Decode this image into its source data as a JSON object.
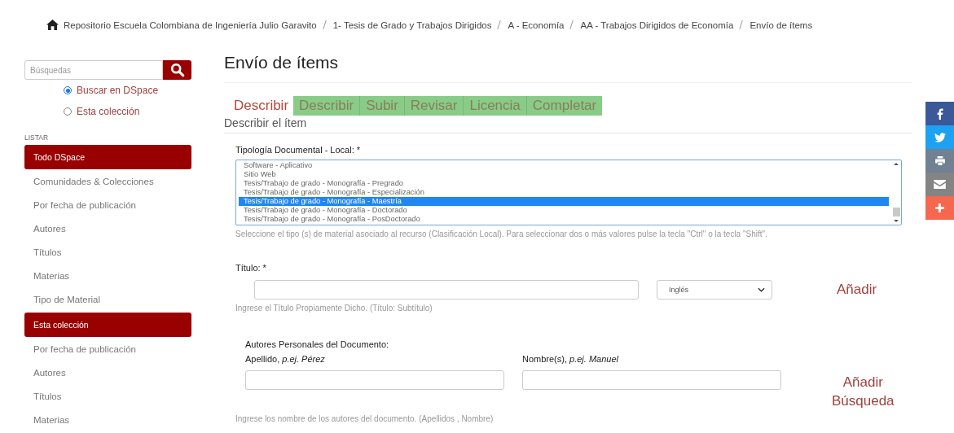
{
  "breadcrumb": [
    "Repositorio Escuela Colombiana de Ingeniería Julio Garavito",
    "1- Tesis de Grado y Trabajos Dirigidos",
    "A - Economía",
    "AA - Trabajos Dirigidos de Economía",
    "Envío de ítems"
  ],
  "search": {
    "placeholder": "Búsquedas",
    "scopes": [
      {
        "label": "Buscar en DSpace",
        "selected": true
      },
      {
        "label": "Esta colección",
        "selected": false
      }
    ]
  },
  "browse": {
    "heading": "LISTAR",
    "items": [
      {
        "label": "Todo DSpace",
        "kind": "header"
      },
      {
        "label": "Comunidades & Colecciones",
        "kind": "link"
      },
      {
        "label": "Por fecha de publicación",
        "kind": "link"
      },
      {
        "label": "Autores",
        "kind": "link"
      },
      {
        "label": "Títulos",
        "kind": "link"
      },
      {
        "label": "Materias",
        "kind": "link"
      },
      {
        "label": "Tipo de Material",
        "kind": "link"
      },
      {
        "label": "Esta colección",
        "kind": "header"
      },
      {
        "label": "Por fecha de publicación",
        "kind": "link"
      },
      {
        "label": "Autores",
        "kind": "link"
      },
      {
        "label": "Títulos",
        "kind": "link"
      },
      {
        "label": "Materias",
        "kind": "link"
      }
    ]
  },
  "page_title": "Envío de ítems",
  "stage_label": "Describir",
  "steps": [
    "Describir",
    "Subir",
    "Revisar",
    "Licencia",
    "Completar"
  ],
  "section_title": "Describir el ítem",
  "tipologia": {
    "label": "Tipología Documental - Local: *",
    "options": [
      {
        "label": "Software - Aplicativo",
        "selected": false
      },
      {
        "label": "Sitio Web",
        "selected": false
      },
      {
        "label": "Tesis/Trabajo de grado - Monografía - Pregrado",
        "selected": false
      },
      {
        "label": "Tesis/Trabajo de grado - Monografía - Especialización",
        "selected": false
      },
      {
        "label": "Tesis/Trabajo de grado - Monografía - Maestría",
        "selected": true
      },
      {
        "label": "Tesis/Trabajo de grado - Monografía - Doctorado",
        "selected": false
      },
      {
        "label": "Tesis/Trabajo de grado - Monografía - PosDoctorado",
        "selected": false
      }
    ],
    "help": "Seleccione el tipo (s) de material asociado al recurso (Clasificación Local). Para seleccionar dos o más valores pulse la tecla \"Ctrl\" o la tecla \"Shift\"."
  },
  "titulo": {
    "label": "Título: *",
    "language": "Inglés",
    "add": "Añadir",
    "help": "Ingrese el Título Propiamente Dicho. (Título: Subtítulo)"
  },
  "autores": {
    "label": "Autores Personales del Documento:",
    "surname_label": "Apellido, *p.ej. Pérez*",
    "name_label": "Nombre(s), *p.ej. Manuel*",
    "add": "Añadir",
    "lookup": "Búsqueda",
    "help": "Ingrese los nombre de los autores del documento. (Apellidos , Nombre)"
  },
  "share": [
    {
      "kind": "facebook",
      "color": "#3b5998"
    },
    {
      "kind": "twitter",
      "color": "#1da1f2"
    },
    {
      "kind": "print",
      "color": "#718191"
    },
    {
      "kind": "email",
      "color": "#848484"
    },
    {
      "kind": "more",
      "color": "#f6674f"
    }
  ]
}
